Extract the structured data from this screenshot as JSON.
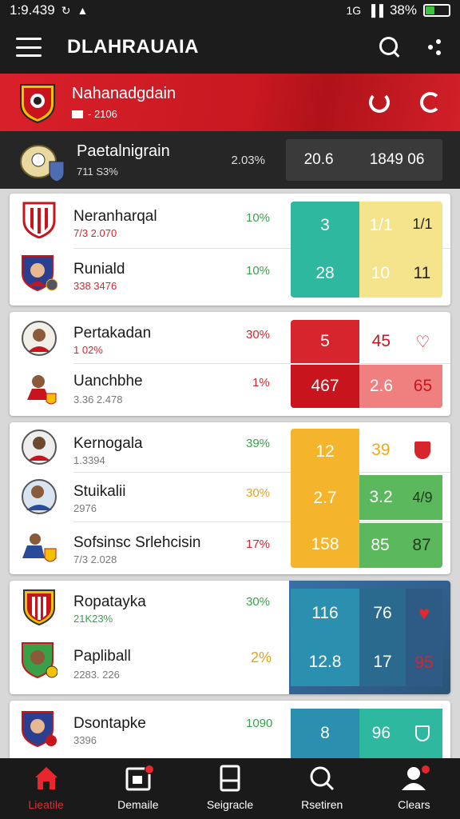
{
  "status": {
    "time": "1:9.439",
    "signal": "1G",
    "battery": "38%",
    "battery_level": 0.38
  },
  "app": {
    "title": "DLAHRAUAIA"
  },
  "featured": {
    "name": "Nahanadgdain",
    "sub": "- 2106"
  },
  "top_match": {
    "name": "Paetalnigrain",
    "sub": "711 S3%",
    "pct": "2.03%",
    "odds": [
      "20.6",
      "1849 06"
    ]
  },
  "cards": [
    {
      "rows": [
        {
          "name": "Neranharqal",
          "sub": "7/3 2.070",
          "pct": "10%"
        },
        {
          "name": "Runiald",
          "sub": "338 3476",
          "pct": "10%"
        }
      ],
      "odds": [
        [
          "3",
          "1/1",
          "1/1"
        ],
        [
          "28",
          "10",
          "11"
        ]
      ]
    },
    {
      "rows": [
        {
          "name": "Pertakadan",
          "sub": "1 02%",
          "pct": "30%"
        },
        {
          "name": "Uanchbhe",
          "sub": "3.36 2.478",
          "pct": "1%"
        }
      ],
      "odds": [
        [
          "5",
          "45"
        ],
        [
          "467",
          "2.6",
          "65"
        ]
      ]
    },
    {
      "rows": [
        {
          "name": "Kernogala",
          "sub": "1.3394",
          "pct": "39%"
        },
        {
          "name": "Stuikalii",
          "sub": "2976",
          "pct": "30%"
        },
        {
          "name": "Sofsinsc Srlehcisin",
          "sub": "7/3 2.028",
          "pct": "17%"
        }
      ],
      "odds": [
        [
          "12",
          "39"
        ],
        [
          "2.7",
          "3.2",
          "4/9"
        ],
        [
          "158",
          "85",
          "87"
        ]
      ]
    },
    {
      "rows": [
        {
          "name": "Ropatayka",
          "sub": "21K23%",
          "pct": "30%"
        },
        {
          "name": "Papliball",
          "sub": "2283. 226",
          "pct": "2%"
        }
      ],
      "odds": [
        [
          "116",
          "76"
        ],
        [
          "12.8",
          "17",
          "95"
        ]
      ]
    },
    {
      "rows": [
        {
          "name": "Dsontapke",
          "sub": "3396",
          "pct": "1090"
        }
      ],
      "odds": [
        [
          "8",
          "96"
        ]
      ]
    }
  ],
  "nav": [
    {
      "label": "Lieatile"
    },
    {
      "label": "Demaile"
    },
    {
      "label": "Seigracle"
    },
    {
      "label": "Rsetiren"
    },
    {
      "label": "Clears"
    }
  ],
  "colors": {
    "accent": "#e8262d",
    "teal": "#2fb8a0",
    "yellow": "#f6e48d",
    "red": "#d7252d",
    "salmon": "#f08080",
    "orange": "#f4b52c",
    "green": "#5cb85c",
    "steel": "#2b7e9e",
    "navy": "#2a5578"
  }
}
